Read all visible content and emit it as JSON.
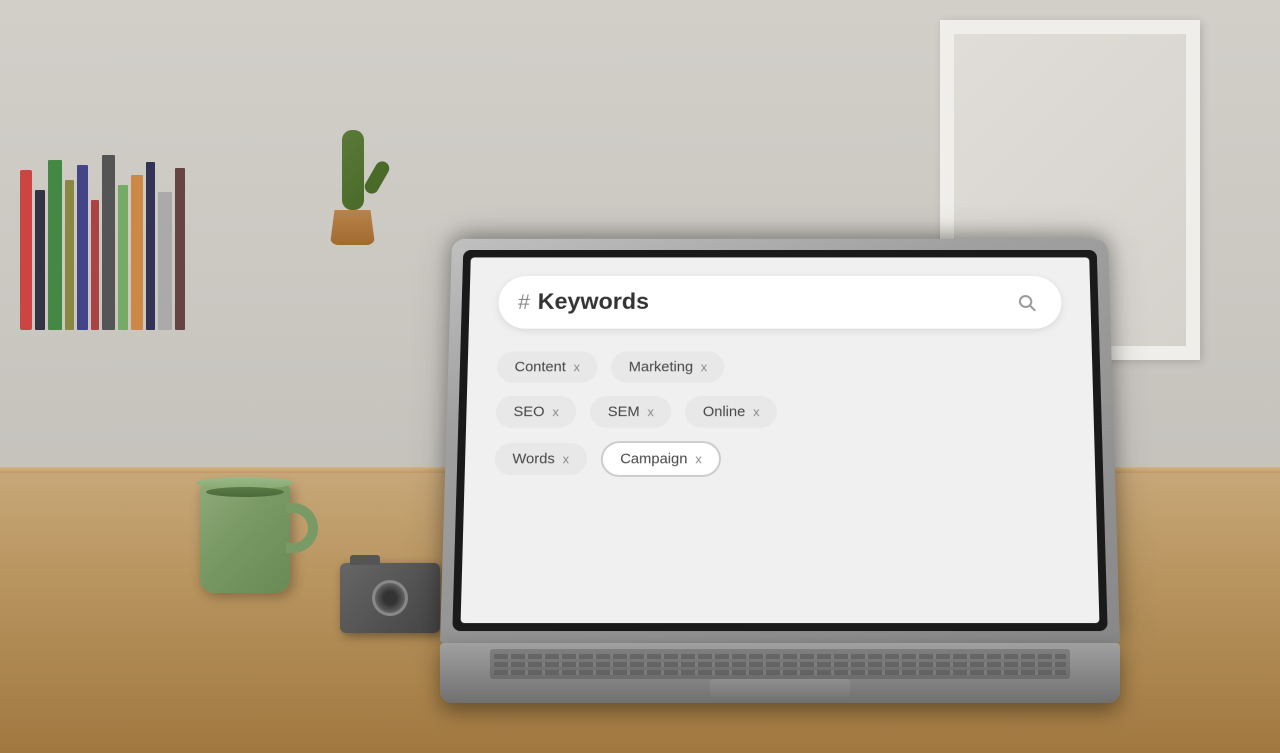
{
  "scene": {
    "search": {
      "hash_symbol": "#",
      "placeholder": "Keywords",
      "search_icon": "🔍"
    },
    "tags": [
      {
        "id": "content",
        "label": "Content",
        "selected": false
      },
      {
        "id": "marketing",
        "label": "Marketing",
        "selected": false
      },
      {
        "id": "seo",
        "label": "SEO",
        "selected": false
      },
      {
        "id": "sem",
        "label": "SEM",
        "selected": false
      },
      {
        "id": "online",
        "label": "Online",
        "selected": false
      },
      {
        "id": "words",
        "label": "Words",
        "selected": false
      },
      {
        "id": "campaign",
        "label": "Campaign",
        "selected": true
      }
    ],
    "tag_close": "x"
  }
}
